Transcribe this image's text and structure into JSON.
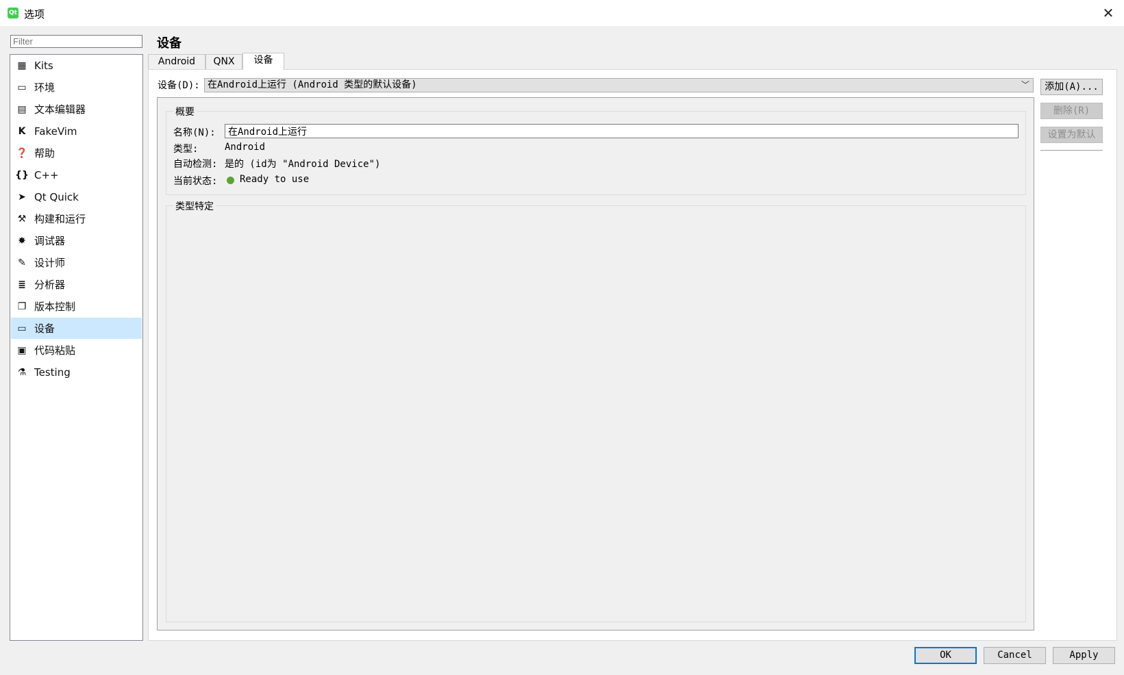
{
  "window": {
    "title": "选项",
    "app_icon_text": "Qt",
    "close": "✕"
  },
  "filter": {
    "placeholder": "Filter"
  },
  "sidebar": {
    "items": [
      {
        "label": "Kits",
        "icon": "kits-icon",
        "glyph": "▦"
      },
      {
        "label": "环境",
        "icon": "monitor-icon",
        "glyph": "▭"
      },
      {
        "label": "文本编辑器",
        "icon": "text-editor-icon",
        "glyph": "▤"
      },
      {
        "label": "FakeVim",
        "icon": "fakevim-icon",
        "glyph": "K"
      },
      {
        "label": "帮助",
        "icon": "help-icon",
        "glyph": "❓"
      },
      {
        "label": "C++",
        "icon": "cpp-braces-icon",
        "glyph": "{}"
      },
      {
        "label": "Qt Quick",
        "icon": "qtquick-plane-icon",
        "glyph": "➤"
      },
      {
        "label": "构建和运行",
        "icon": "hammer-icon",
        "glyph": "⚒"
      },
      {
        "label": "调试器",
        "icon": "bug-icon",
        "glyph": "✸"
      },
      {
        "label": "设计师",
        "icon": "pencil-icon",
        "glyph": "✎"
      },
      {
        "label": "分析器",
        "icon": "analyzer-icon",
        "glyph": "≣"
      },
      {
        "label": "版本控制",
        "icon": "version-control-icon",
        "glyph": "❐"
      },
      {
        "label": "设备",
        "icon": "device-icon",
        "glyph": "▭",
        "selected": true
      },
      {
        "label": "代码粘贴",
        "icon": "clipboard-icon",
        "glyph": "▣"
      },
      {
        "label": "Testing",
        "icon": "flask-icon",
        "glyph": "⚗"
      }
    ]
  },
  "page_title": "设备",
  "tabs": [
    {
      "label": "Android"
    },
    {
      "label": "QNX"
    },
    {
      "label": "设备",
      "active": true
    }
  ],
  "device_row": {
    "label": "设备(D):",
    "value": "在Android上运行 (Android 类型的默认设备)",
    "arrow": "﹀"
  },
  "side_buttons": {
    "add": "添加(A)...",
    "remove": "删除(R)",
    "set_default": "设置为默认"
  },
  "general": {
    "title": "概要",
    "name_label": "名称(N):",
    "name_value": "在Android上运行",
    "type_label": "类型:",
    "type_value": "Android",
    "auto_label": "自动检测:",
    "auto_value": "是的 (id为 \"Android Device\")",
    "state_label": "当前状态:",
    "state_value": "Ready to use",
    "state_color": "#5aa335"
  },
  "type_specific": {
    "title": "类型特定"
  },
  "footer": {
    "ok": "OK",
    "cancel": "Cancel",
    "apply": "Apply"
  }
}
